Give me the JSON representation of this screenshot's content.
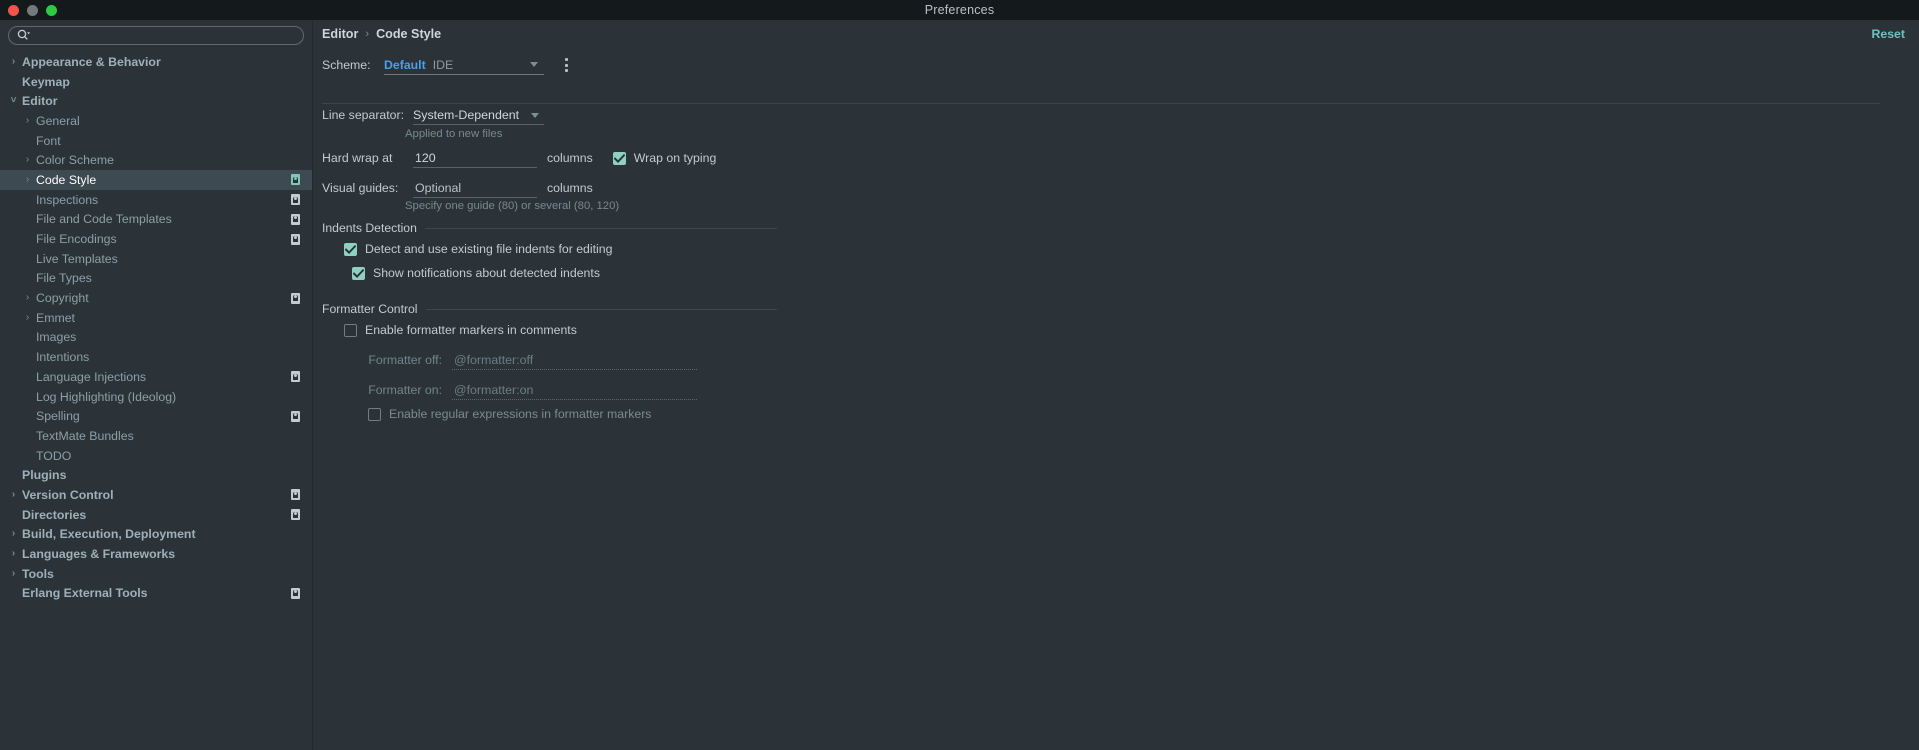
{
  "window": {
    "title": "Preferences",
    "traffic_lights": [
      "close-red",
      "minimize-yellow",
      "zoom-green"
    ]
  },
  "sidebar": {
    "search": {
      "value": "",
      "placeholder": "",
      "icon": "search-icon"
    },
    "items": [
      {
        "label": "Appearance & Behavior",
        "level": 0,
        "bold": true,
        "arrow": "right",
        "badge": false,
        "selected": false
      },
      {
        "label": "Keymap",
        "level": 0,
        "bold": true,
        "arrow": "",
        "badge": false,
        "selected": false
      },
      {
        "label": "Editor",
        "level": 0,
        "bold": true,
        "arrow": "down",
        "badge": false,
        "selected": false
      },
      {
        "label": "General",
        "level": 1,
        "bold": false,
        "arrow": "right",
        "badge": false,
        "selected": false
      },
      {
        "label": "Font",
        "level": 1,
        "bold": false,
        "arrow": "",
        "badge": false,
        "selected": false
      },
      {
        "label": "Color Scheme",
        "level": 1,
        "bold": false,
        "arrow": "right",
        "badge": false,
        "selected": false
      },
      {
        "label": "Code Style",
        "level": 1,
        "bold": false,
        "arrow": "right",
        "badge": true,
        "selected": true
      },
      {
        "label": "Inspections",
        "level": 1,
        "bold": false,
        "arrow": "",
        "badge": true,
        "selected": false
      },
      {
        "label": "File and Code Templates",
        "level": 1,
        "bold": false,
        "arrow": "",
        "badge": true,
        "selected": false
      },
      {
        "label": "File Encodings",
        "level": 1,
        "bold": false,
        "arrow": "",
        "badge": true,
        "selected": false
      },
      {
        "label": "Live Templates",
        "level": 1,
        "bold": false,
        "arrow": "",
        "badge": false,
        "selected": false
      },
      {
        "label": "File Types",
        "level": 1,
        "bold": false,
        "arrow": "",
        "badge": false,
        "selected": false
      },
      {
        "label": "Copyright",
        "level": 1,
        "bold": false,
        "arrow": "right",
        "badge": true,
        "selected": false
      },
      {
        "label": "Emmet",
        "level": 1,
        "bold": false,
        "arrow": "right",
        "badge": false,
        "selected": false
      },
      {
        "label": "Images",
        "level": 1,
        "bold": false,
        "arrow": "",
        "badge": false,
        "selected": false
      },
      {
        "label": "Intentions",
        "level": 1,
        "bold": false,
        "arrow": "",
        "badge": false,
        "selected": false
      },
      {
        "label": "Language Injections",
        "level": 1,
        "bold": false,
        "arrow": "",
        "badge": true,
        "selected": false
      },
      {
        "label": "Log Highlighting (Ideolog)",
        "level": 1,
        "bold": false,
        "arrow": "",
        "badge": false,
        "selected": false
      },
      {
        "label": "Spelling",
        "level": 1,
        "bold": false,
        "arrow": "",
        "badge": true,
        "selected": false
      },
      {
        "label": "TextMate Bundles",
        "level": 1,
        "bold": false,
        "arrow": "",
        "badge": false,
        "selected": false
      },
      {
        "label": "TODO",
        "level": 1,
        "bold": false,
        "arrow": "",
        "badge": false,
        "selected": false
      },
      {
        "label": "Plugins",
        "level": 0,
        "bold": true,
        "arrow": "",
        "badge": false,
        "selected": false
      },
      {
        "label": "Version Control",
        "level": 0,
        "bold": true,
        "arrow": "right",
        "badge": true,
        "selected": false
      },
      {
        "label": "Directories",
        "level": 0,
        "bold": true,
        "arrow": "",
        "badge": true,
        "selected": false
      },
      {
        "label": "Build, Execution, Deployment",
        "level": 0,
        "bold": true,
        "arrow": "right",
        "badge": false,
        "selected": false
      },
      {
        "label": "Languages & Frameworks",
        "level": 0,
        "bold": true,
        "arrow": "right",
        "badge": false,
        "selected": false
      },
      {
        "label": "Tools",
        "level": 0,
        "bold": true,
        "arrow": "right",
        "badge": false,
        "selected": false
      },
      {
        "label": "Erlang External Tools",
        "level": 0,
        "bold": true,
        "arrow": "",
        "badge": true,
        "selected": false
      }
    ]
  },
  "main": {
    "breadcrumb": {
      "parent": "Editor",
      "separator": "›",
      "current": "Code Style"
    },
    "reset_label": "Reset",
    "scheme": {
      "label": "Scheme:",
      "name": "Default",
      "kind": "IDE",
      "kebab_icon": "more-options-icon",
      "caret_icon": "chevron-down-icon"
    },
    "line_separator": {
      "label": "Line separator:",
      "value": "System-Dependent",
      "hint": "Applied to new files"
    },
    "hard_wrap": {
      "label": "Hard wrap at",
      "value": "120",
      "unit": "columns",
      "wrap_on_typing_label": "Wrap on typing",
      "wrap_on_typing_checked": true
    },
    "visual_guides": {
      "label": "Visual guides:",
      "value": "Optional",
      "unit": "columns",
      "hint": "Specify one guide (80) or several (80, 120)"
    },
    "indents_detection": {
      "title": "Indents Detection",
      "options": [
        {
          "label": "Detect and use existing file indents for editing",
          "checked": true,
          "enabled": true
        },
        {
          "label": "Show notifications about detected indents",
          "checked": true,
          "enabled": true
        }
      ]
    },
    "formatter_control": {
      "title": "Formatter Control",
      "enable_markers": {
        "label": "Enable formatter markers in comments",
        "checked": false
      },
      "formatter_off": {
        "label": "Formatter off:",
        "value": "@formatter:off",
        "enabled": false
      },
      "formatter_on": {
        "label": "Formatter on:",
        "value": "@formatter:on",
        "enabled": false
      },
      "enable_regex": {
        "label": "Enable regular expressions in formatter markers",
        "checked": false,
        "enabled": false
      }
    }
  },
  "colors": {
    "background": "#2b3339",
    "titlebar": "#14191c",
    "selection": "#3d4a51",
    "accent_link": "#6fc2c0",
    "scheme_name": "#4a9fe8",
    "checkbox_on": "#8fcfc4"
  }
}
